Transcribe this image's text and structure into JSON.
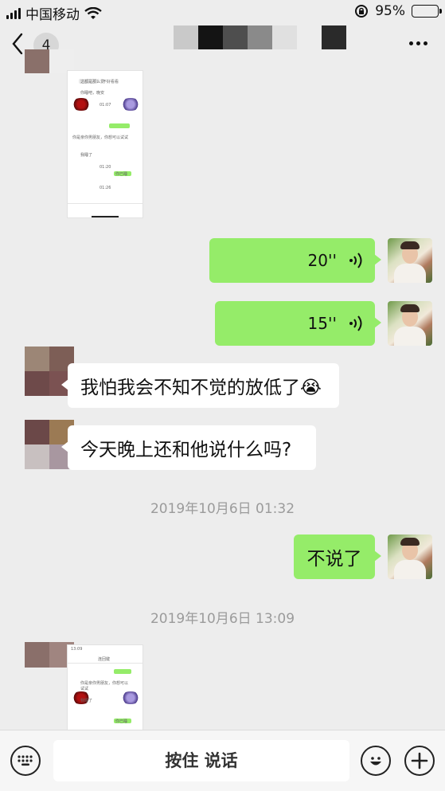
{
  "status_bar": {
    "carrier": "中国移动",
    "battery_percent": "95%",
    "battery_level": 0.95
  },
  "nav": {
    "unread_count": "4",
    "back_icon": "chevron-left-icon",
    "more_icon": "more-dots-icon"
  },
  "messages": {
    "voice_1_duration": "20''",
    "voice_2_duration": "15''",
    "text_1": "我怕我会不知不觉的放低了😭",
    "text_2": "今天晚上还和他说什么吗?",
    "timestamp_1": "2019年10月6日 01:32",
    "text_3": "不说了",
    "timestamp_2": "2019年10月6日 13:09"
  },
  "thumbnail_1": {
    "rows": [
      "这都是那么爱",
      "不好看看",
      "你睡吧，晚安",
      "你是亲你男朋友，你想可以试试",
      "我睡了",
      "你已睡"
    ],
    "times": [
      "01:07",
      "01:20",
      "01:26"
    ]
  },
  "thumbnail_2": {
    "status_time": "13:09",
    "title": "连回键",
    "rows": [
      "你是亲你男朋友，你想可以试试",
      "我睡了",
      "你已睡"
    ]
  },
  "input_bar": {
    "hold_to_talk": "按住 说话",
    "keyboard_icon": "keyboard-icon",
    "emoji_icon": "emoji-icon",
    "plus_icon": "plus-icon"
  },
  "colors": {
    "background": "#ededed",
    "my_bubble": "#95ec69",
    "other_bubble": "#ffffff"
  }
}
